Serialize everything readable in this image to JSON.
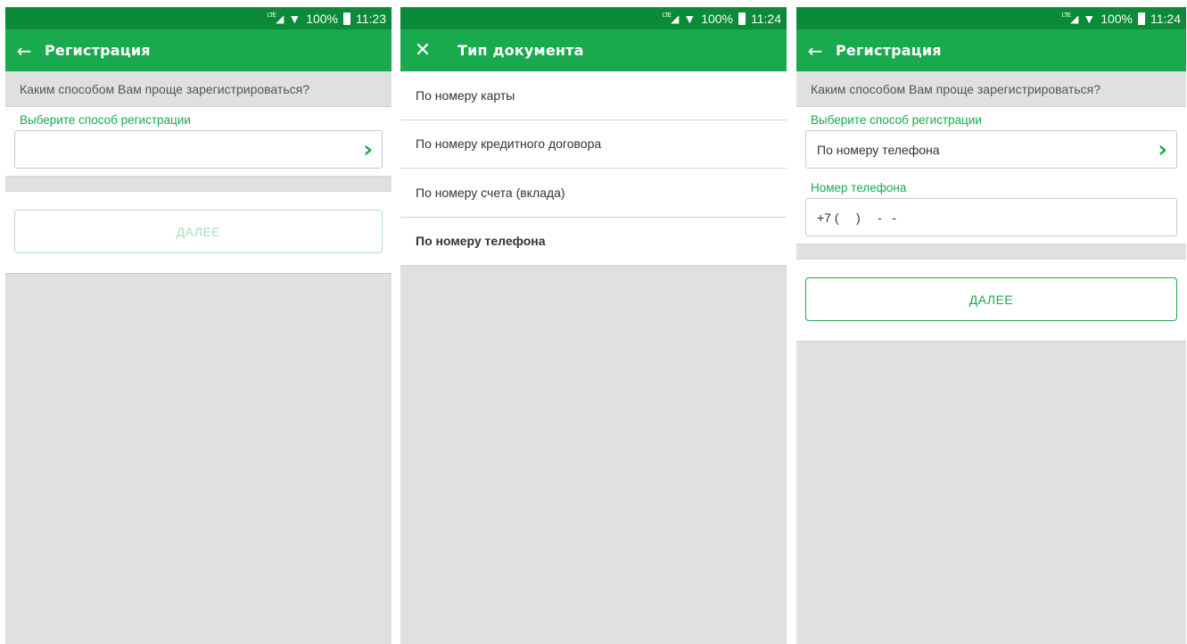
{
  "screens": [
    {
      "status": {
        "network": "LTE",
        "battery": "100%",
        "time": "11:23"
      },
      "appbar": {
        "title": "Регистрация",
        "nav_icon": "←"
      },
      "prompt": "Каким способом Вам проще зарегистрироваться?",
      "method": {
        "label": "Выберите способ регистрации",
        "value": ""
      },
      "next_button": "ДАЛЕЕ"
    },
    {
      "status": {
        "network": "LTE",
        "battery": "100%",
        "time": "11:24"
      },
      "appbar": {
        "title": "Тип документа",
        "nav_icon": "✕"
      },
      "options": [
        "По номеру карты",
        "По номеру кредитного договора",
        "По номеру счета (вклада)",
        "По номеру телефона"
      ],
      "selected_option": "По номеру телефона"
    },
    {
      "status": {
        "network": "LTE",
        "battery": "100%",
        "time": "11:24"
      },
      "appbar": {
        "title": "Регистрация",
        "nav_icon": "←"
      },
      "prompt": "Каким способом Вам проще зарегистрироваться?",
      "method": {
        "label": "Выберите способ регистрации",
        "value": "По номеру телефона"
      },
      "phone": {
        "label": "Номер телефона",
        "mask": "+7 (     )     -   -"
      },
      "next_button": "ДАЛЕЕ"
    }
  ],
  "icons": {
    "chevron": "›",
    "signal": "LTE",
    "wifi": "▼"
  },
  "colors": {
    "appbar": "#19aa4d",
    "statusbar": "#0b8a3a",
    "accent": "#19aa4d",
    "background": "#e0e0e0"
  }
}
